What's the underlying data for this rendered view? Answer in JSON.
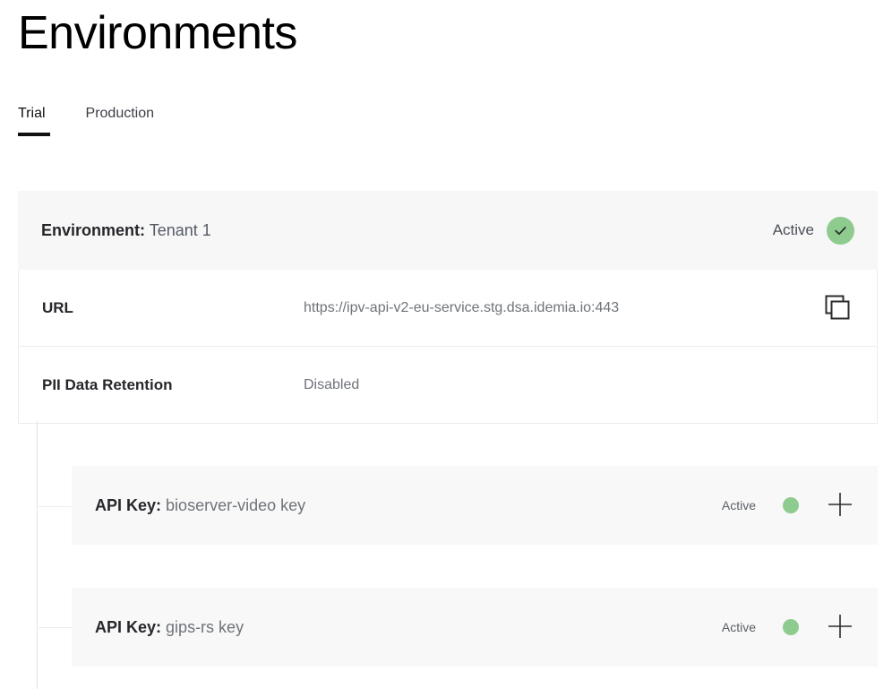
{
  "page": {
    "title": "Environments"
  },
  "tabs": [
    {
      "label": "Trial",
      "active": true
    },
    {
      "label": "Production",
      "active": false
    }
  ],
  "environment": {
    "header": {
      "label": "Environment:",
      "name": "Tenant 1",
      "status_text": "Active",
      "status_icon": "check-circle-icon"
    },
    "rows": [
      {
        "label": "URL",
        "value": "https://ipv-api-v2-eu-service.stg.dsa.idemia.io:443",
        "action_icon": "copy-icon"
      },
      {
        "label": "PII Data Retention",
        "value": "Disabled"
      }
    ]
  },
  "api_keys": [
    {
      "label": "API Key:",
      "name": "bioserver-video key",
      "status_text": "Active",
      "status_dot": "green-dot-icon",
      "action_icon": "plus-icon"
    },
    {
      "label": "API Key:",
      "name": "gips-rs key",
      "status_text": "Active",
      "status_dot": "green-dot-icon",
      "action_icon": "plus-icon"
    }
  ],
  "colors": {
    "status_green": "#8ecb8e",
    "accent_underline": "#111111",
    "row_background": "#f8f8f8",
    "border": "#ececec"
  }
}
